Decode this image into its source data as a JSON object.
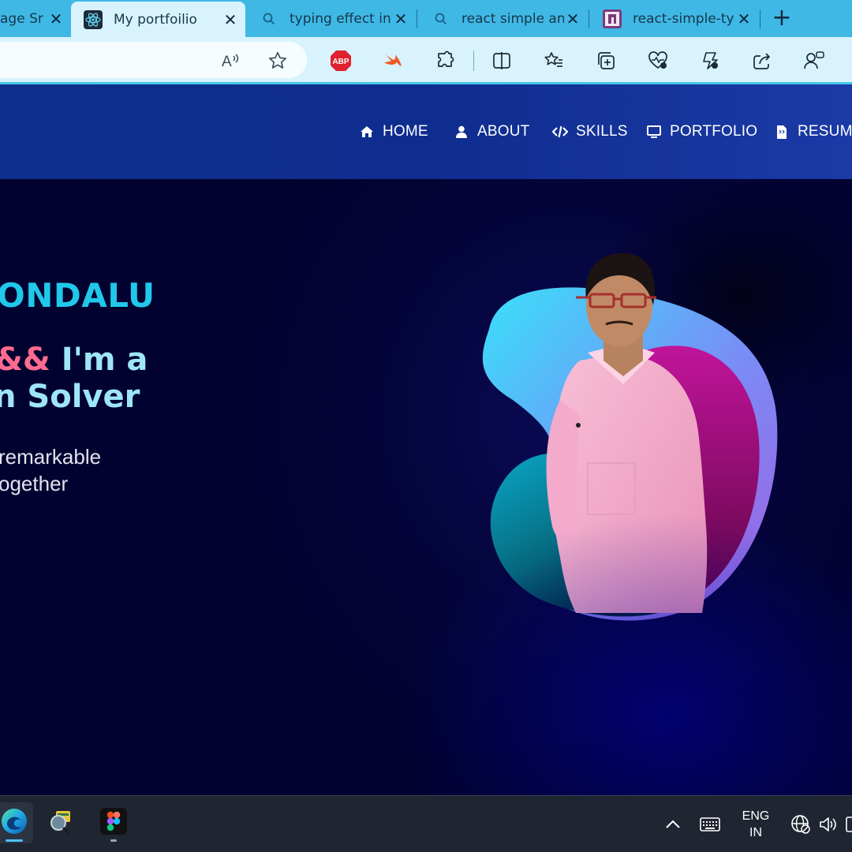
{
  "browser": {
    "tabs": [
      {
        "title": "age Sr",
        "active": false,
        "favicon": "image-icon"
      },
      {
        "title": "My portfoilio",
        "active": true,
        "favicon": "react-icon"
      },
      {
        "title": "typing effect in",
        "active": false,
        "favicon": "search-icon"
      },
      {
        "title": "react simple an",
        "active": false,
        "favicon": "search-icon"
      },
      {
        "title": "react-simple-ty",
        "active": false,
        "favicon": "npm-icon"
      }
    ],
    "toolbar_icons": [
      "read-aloud-icon",
      "favorite-star-icon",
      "adblock-plus-icon",
      "swift-icon",
      "extensions-icon",
      "split-screen-icon",
      "favorites-icon",
      "collections-icon",
      "browser-essentials-icon",
      "copilot-icon",
      "share-icon",
      "feedback-icon"
    ],
    "adblock_label": "ABP"
  },
  "navbar": {
    "items": [
      {
        "label": "HOME",
        "icon": "home-icon"
      },
      {
        "label": "ABOUT",
        "icon": "user-icon"
      },
      {
        "label": "SKILLS",
        "icon": "code-icon"
      },
      {
        "label": "PORTFOLIO",
        "icon": "monitor-icon"
      },
      {
        "label": "RESUME",
        "icon": "file-icon"
      }
    ]
  },
  "hero": {
    "name": "ONDALU",
    "line1_amp": "&&",
    "line1_rest": " I'm a",
    "line2": "n Solver",
    "desc_line1": "remarkable",
    "desc_line2": "ogether",
    "colors": {
      "name": "#20c8ea",
      "heading": "#9ee6f7",
      "amp": "#ff6b8e",
      "desc": "#e2e2ee"
    }
  },
  "taskbar": {
    "apps": [
      "edge-icon",
      "magnifier-app-icon",
      "figma-icon"
    ],
    "tray": [
      "chevron-up-icon",
      "keyboard-icon",
      "network-icon",
      "volume-icon"
    ],
    "language_line1": "ENG",
    "language_line2": "IN"
  }
}
